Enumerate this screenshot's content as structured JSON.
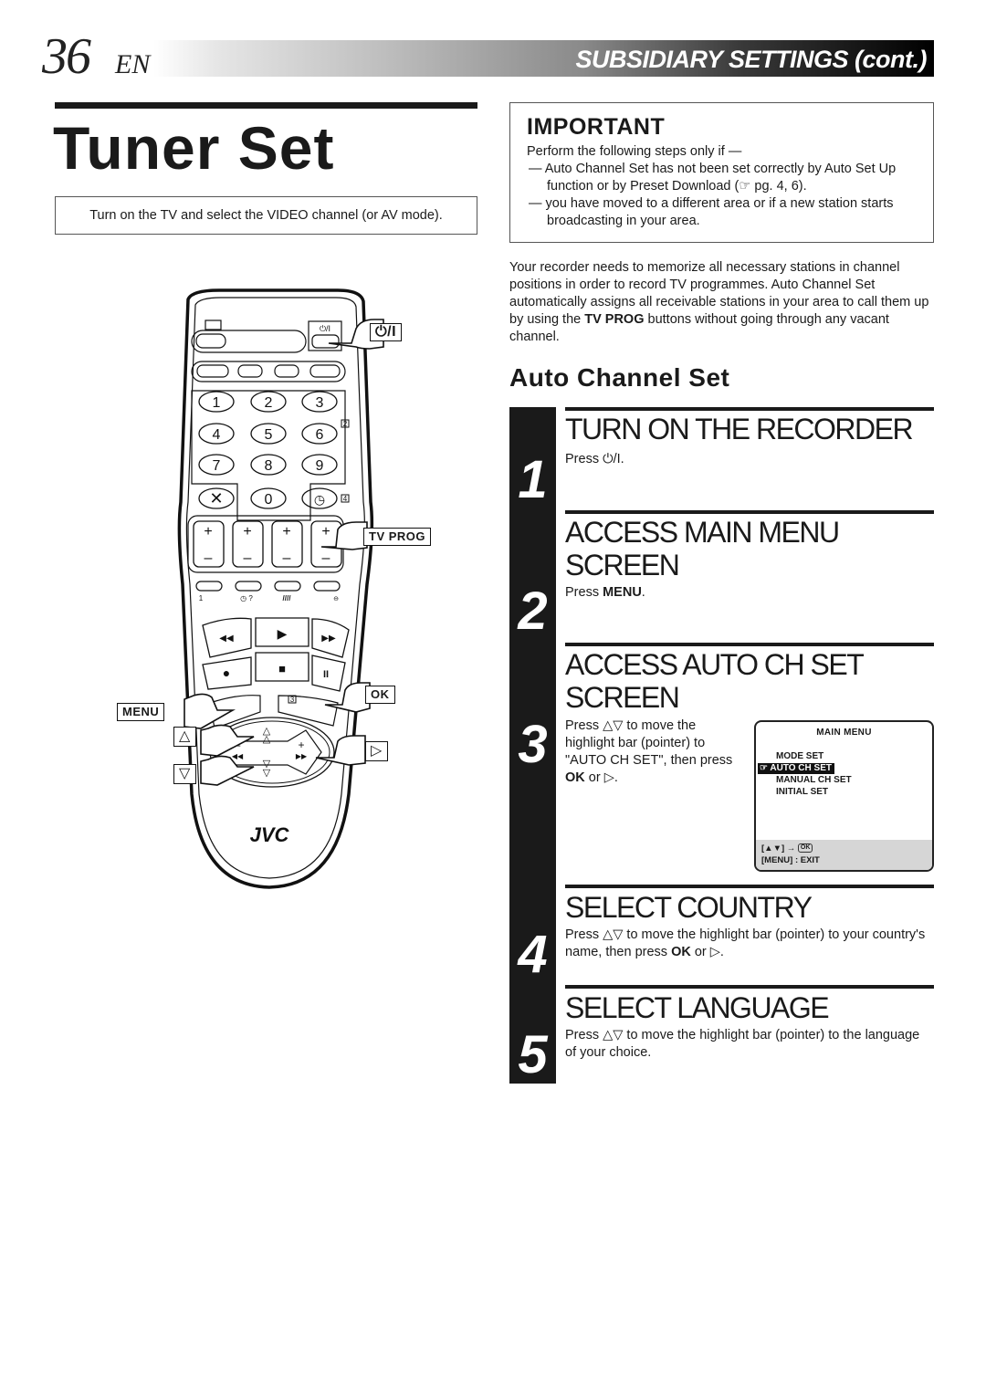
{
  "header": {
    "page_number": "36",
    "language": "EN",
    "section": "SUBSIDIARY SETTINGS",
    "section_suffix": "(cont.)"
  },
  "page_title": "Tuner Set",
  "tv_note": "Turn on the TV and select the VIDEO channel (or AV mode).",
  "important": {
    "title": "IMPORTANT",
    "lead": "Perform the following steps only if —",
    "items": [
      "— Auto Channel Set has not been set correctly by Auto Set Up function or by Preset Download (☞ pg. 4, 6).",
      "— you have moved to a different area or if a new station starts broadcasting in your area."
    ]
  },
  "intro": {
    "before": "Your recorder needs to memorize all necessary stations in channel positions in order to record TV programmes. Auto Channel Set automatically assigns all receivable stations in your area to call them up by using the ",
    "bold": "TV PROG",
    "after": " buttons without going through any vacant channel."
  },
  "section_title": "Auto Channel Set",
  "steps": [
    {
      "number": "1",
      "heading": "TURN ON THE RECORDER",
      "text_before": "Press ",
      "bold": "",
      "text_after": "⏻/I."
    },
    {
      "number": "2",
      "heading": "ACCESS MAIN MENU SCREEN",
      "text_before": "Press ",
      "bold": "MENU",
      "text_after": "."
    },
    {
      "number": "3",
      "heading": "ACCESS AUTO CH SET SCREEN",
      "text_before": "Press △▽ to move the highlight bar (pointer) to \"AUTO CH SET\", then press ",
      "bold": "OK",
      "text_after": " or ▷."
    },
    {
      "number": "4",
      "heading": "SELECT COUNTRY",
      "text_before": "Press △▽ to move the highlight bar (pointer) to your country's name, then press ",
      "bold": "OK",
      "text_after": " or ▷."
    },
    {
      "number": "5",
      "heading": "SELECT LANGUAGE",
      "text_before": "Press △▽ to move the highlight bar (pointer) to the language of your choice.",
      "bold": "",
      "text_after": ""
    }
  ],
  "osd": {
    "title": "MAIN MENU",
    "items": [
      "MODE SET",
      "AUTO CH SET",
      "MANUAL CH SET",
      "INITIAL SET"
    ],
    "selected_index": 1,
    "footer_nav": "[▲▼] →",
    "footer_ok": "OK",
    "footer_exit": "[MENU] : EXIT"
  },
  "remote": {
    "brand": "JVC",
    "callouts": {
      "power": "⏻/I",
      "tv_prog": "TV PROG",
      "ok": "OK",
      "menu": "MENU",
      "up": "△",
      "down": "▽",
      "right": "▷"
    },
    "number_keys": [
      "1",
      "2",
      "3",
      "4",
      "5",
      "6",
      "7",
      "8",
      "9",
      "0"
    ],
    "small_labels": {
      "power_small": "⏻/I",
      "box2": "2",
      "box4": "4",
      "box1": "1",
      "box3": "3"
    }
  }
}
